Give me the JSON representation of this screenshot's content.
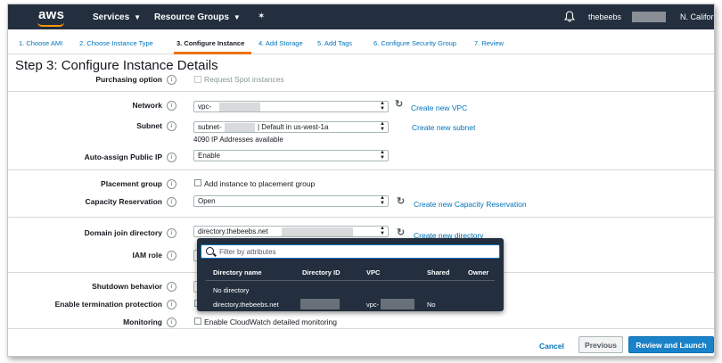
{
  "topnav": {
    "logo": "aws",
    "services": "Services",
    "resource_groups": "Resource Groups",
    "pin_icon": "pin-icon",
    "bell_icon": "bell-icon",
    "user": "thebeebs",
    "region": "N. Californ"
  },
  "tabs": [
    {
      "label": "1. Choose AMI",
      "active": false
    },
    {
      "label": "2. Choose Instance Type",
      "active": false
    },
    {
      "label": "3. Configure Instance",
      "active": true
    },
    {
      "label": "4. Add Storage",
      "active": false
    },
    {
      "label": "5. Add Tags",
      "active": false
    },
    {
      "label": "6. Configure Security Group",
      "active": false
    },
    {
      "label": "7. Review",
      "active": false
    }
  ],
  "page": {
    "title": "Step 3: Configure Instance Details"
  },
  "form": {
    "purchasing": {
      "label": "Purchasing option",
      "checkbox": "Request Spot instances"
    },
    "network": {
      "label": "Network",
      "value": "vpc-",
      "link": "Create new VPC"
    },
    "subnet": {
      "label": "Subnet",
      "value_prefix": "subnet-",
      "value_suffix": "| Default in us-west-1a",
      "info": "4090 IP Addresses available",
      "link": "Create new subnet"
    },
    "public_ip": {
      "label": "Auto-assign Public IP",
      "value": "Enable"
    },
    "placement": {
      "label": "Placement group",
      "checkbox": "Add instance to placement group"
    },
    "capacity": {
      "label": "Capacity Reservation",
      "value": "Open",
      "link": "Create new Capacity Reservation"
    },
    "domain": {
      "label": "Domain join directory",
      "value": "directory.thebeebs.net",
      "link": "Create new directory"
    },
    "iam": {
      "label": "IAM role"
    },
    "shutdown": {
      "label": "Shutdown behavior"
    },
    "termination": {
      "label": "Enable termination protection"
    },
    "monitoring": {
      "label": "Monitoring",
      "checkbox": "Enable CloudWatch detailed monitoring"
    }
  },
  "dropdown": {
    "filter_placeholder": "Filter by attributes",
    "columns": [
      "Directory name",
      "Directory ID",
      "VPC",
      "Shared",
      "Owner"
    ],
    "rows": [
      {
        "name": "No directory"
      },
      {
        "name": "directory.thebeebs.net",
        "vpc": "vpc-",
        "shared": "No"
      }
    ]
  },
  "footer": {
    "cancel": "Cancel",
    "previous": "Previous",
    "review": "Review and Launch"
  },
  "colors": {
    "nav_bg": "#232f3e",
    "accent_orange": "#ec7211",
    "link_blue": "#0073bb",
    "primary_button": "#1a82c9"
  }
}
